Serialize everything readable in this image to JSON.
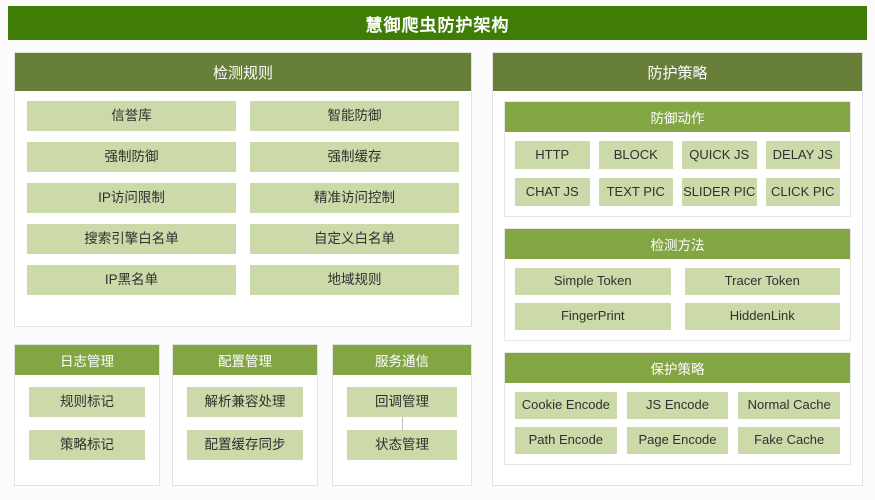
{
  "title": "慧御爬虫防护架构",
  "colors": {
    "title_bar": "#3f7d06",
    "header_dark": "#677f38",
    "header_light": "#83a543",
    "tile": "#cbdaa8",
    "panel_bg": "#ffffff",
    "page_bg": "#fcfcfc"
  },
  "detection_rules": {
    "header": "检测规则",
    "items": [
      "信誉库",
      "智能防御",
      "强制防御",
      "强制缓存",
      "IP访问限制",
      "精准访问控制",
      "搜索引擎白名单",
      "自定义白名单",
      "IP黑名单",
      "地域规则"
    ]
  },
  "log_management": {
    "header": "日志管理",
    "items": [
      "规则标记",
      "策略标记"
    ]
  },
  "config_management": {
    "header": "配置管理",
    "items": [
      "解析兼容处理",
      "配置缓存同步"
    ]
  },
  "service_communication": {
    "header": "服务通信",
    "items": [
      "回调管理",
      "状态管理"
    ],
    "has_connector": true
  },
  "protection_strategy": {
    "header": "防护策略",
    "defense_actions": {
      "header": "防御动作",
      "items": [
        "HTTP",
        "BLOCK",
        "QUICK JS",
        "DELAY JS",
        "CHAT JS",
        "TEXT PIC",
        "SLIDER PIC",
        "CLICK PIC"
      ]
    },
    "detection_methods": {
      "header": "检测方法",
      "items": [
        "Simple Token",
        "Tracer Token",
        "FingerPrint",
        "HiddenLink"
      ]
    },
    "protect_policies": {
      "header": "保护策略",
      "items": [
        "Cookie Encode",
        "JS Encode",
        "Normal Cache",
        "Path Encode",
        "Page Encode",
        "Fake Cache"
      ]
    }
  }
}
